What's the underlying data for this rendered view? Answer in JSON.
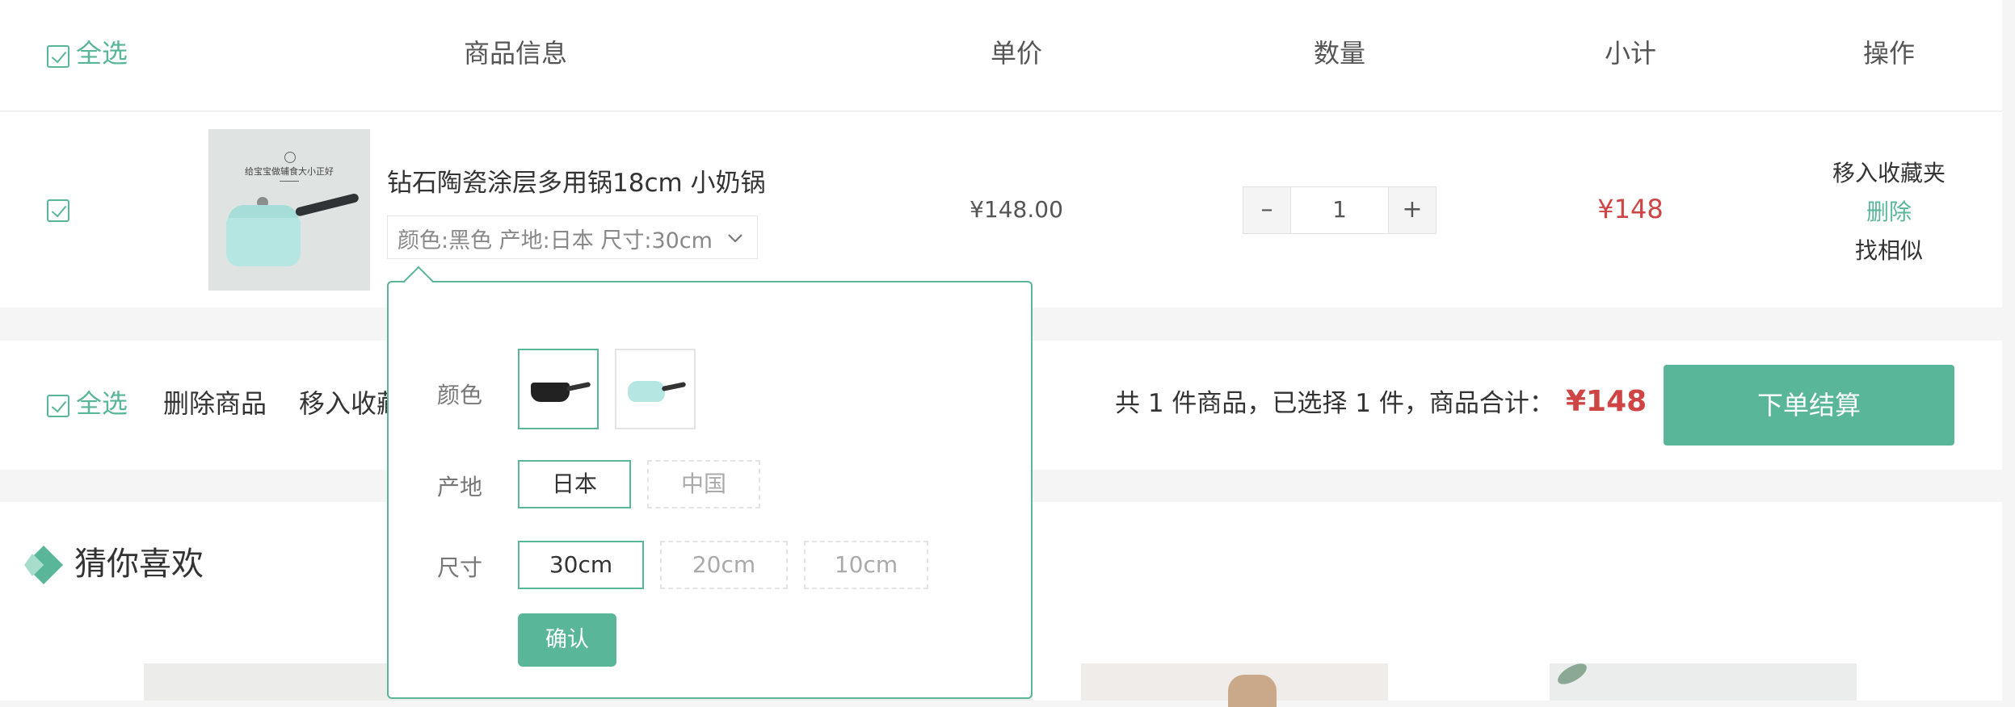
{
  "header": {
    "select_all": "全选",
    "col_info": "商品信息",
    "col_price": "单价",
    "col_qty": "数量",
    "col_subtotal": "小计",
    "col_action": "操作"
  },
  "item": {
    "name": "钻石陶瓷涂层多用锅18cm 小奶锅",
    "spec": "颜色:黑色 产地:日本 尺寸:30cm",
    "image_caption": "给宝宝做辅食大小正好",
    "price": "¥148.00",
    "qty": "1",
    "subtotal": "¥148",
    "actions": {
      "favorite": "移入收藏夹",
      "delete": "删除",
      "similar": "找相似"
    }
  },
  "footer": {
    "select_all": "全选",
    "delete_selected": "删除商品",
    "move_to_favorites": "移入收藏",
    "summary": "共 1 件商品，已选择 1 件，商品合计：",
    "total": "¥148",
    "checkout": "下单结算"
  },
  "recommend": {
    "title": "猜你喜欢"
  },
  "popup": {
    "color_label": "颜色",
    "origin_label": "产地",
    "size_label": "尺寸",
    "origins": [
      "日本",
      "中国"
    ],
    "sizes": [
      "30cm",
      "20cm",
      "10cm"
    ],
    "confirm": "确认"
  },
  "colors": {
    "accent": "#5ab699",
    "price_red": "#cf4444"
  }
}
